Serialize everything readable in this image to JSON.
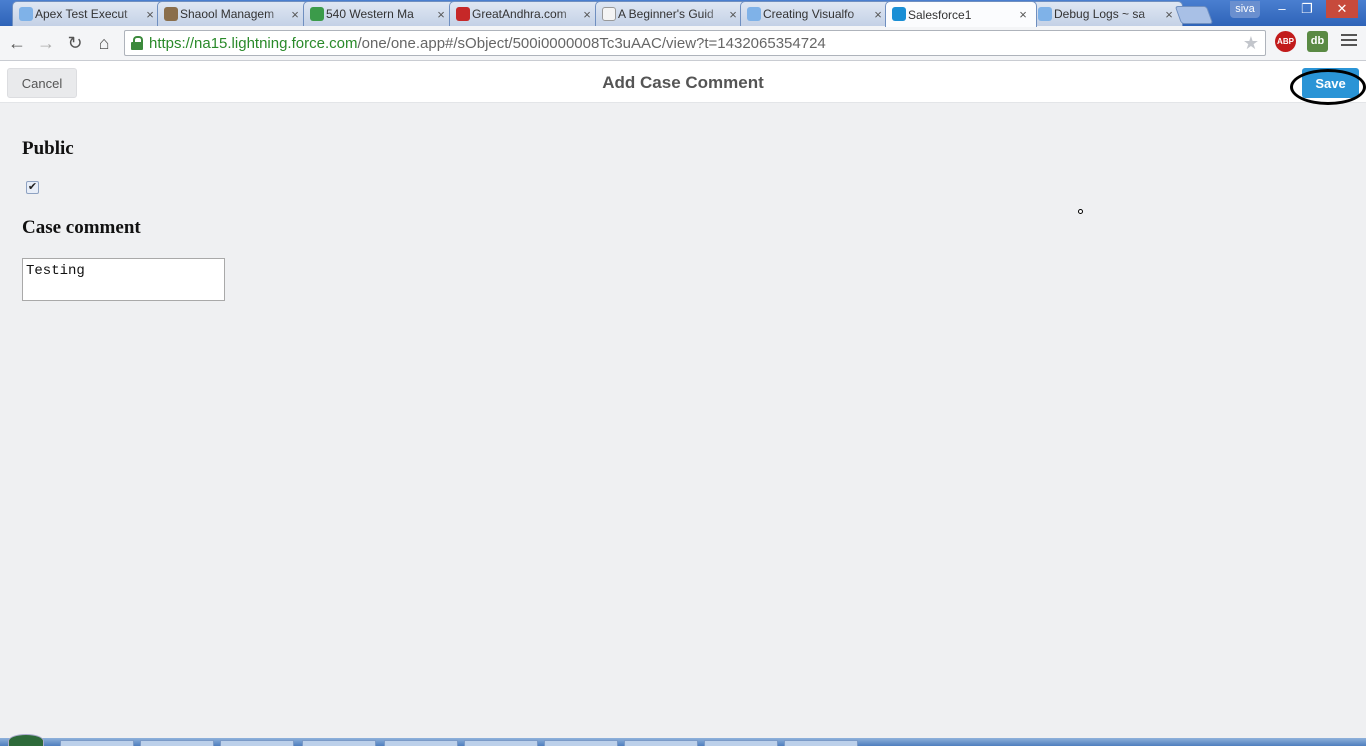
{
  "browser": {
    "tabs": [
      {
        "title": "Apex Test Execut",
        "favicon_color": "#7fb2e8",
        "active": false
      },
      {
        "title": "Shaool Managem",
        "favicon_color": "#8a6e4b",
        "active": false
      },
      {
        "title": "540 Western Ma",
        "favicon_color": "#3b9b4a",
        "active": false
      },
      {
        "title": "GreatAndhra.com",
        "favicon_color": "#c62828",
        "active": false
      },
      {
        "title": "A Beginner's Guid",
        "favicon_color": "#f4f4f4",
        "active": false
      },
      {
        "title": "Creating Visualfo",
        "favicon_color": "#7fb2e8",
        "active": false
      },
      {
        "title": "Salesforce1",
        "favicon_color": "#1a8fd5",
        "active": true
      },
      {
        "title": "Debug Logs ~ sa",
        "favicon_color": "#7fb2e8",
        "active": false
      }
    ],
    "tab_close_glyph": "×",
    "user_badge": "siva",
    "window_controls": {
      "minimize": "–",
      "restore": "❐",
      "close": "✕"
    },
    "nav": {
      "back": "←",
      "forward": "→",
      "reload": "↻",
      "home": "⌂"
    },
    "url": {
      "host": "https://na15.lightning.force.com",
      "path": "/one/one.app#/sObject/500i0000008Tc3uAAC/view?t=1432065354724"
    },
    "bookmark_star": "★",
    "extensions": {
      "adblock": "ABP",
      "db": "db"
    }
  },
  "header": {
    "cancel_label": "Cancel",
    "title": "Add Case Comment",
    "save_label": "Save"
  },
  "form": {
    "public_label": "Public",
    "public_checked": "✔",
    "comment_label": "Case comment",
    "comment_value": "Testing"
  },
  "colors": {
    "save_button": "#2a94d6",
    "page_background": "#eff0f2",
    "url_host": "#2a8a2a"
  }
}
